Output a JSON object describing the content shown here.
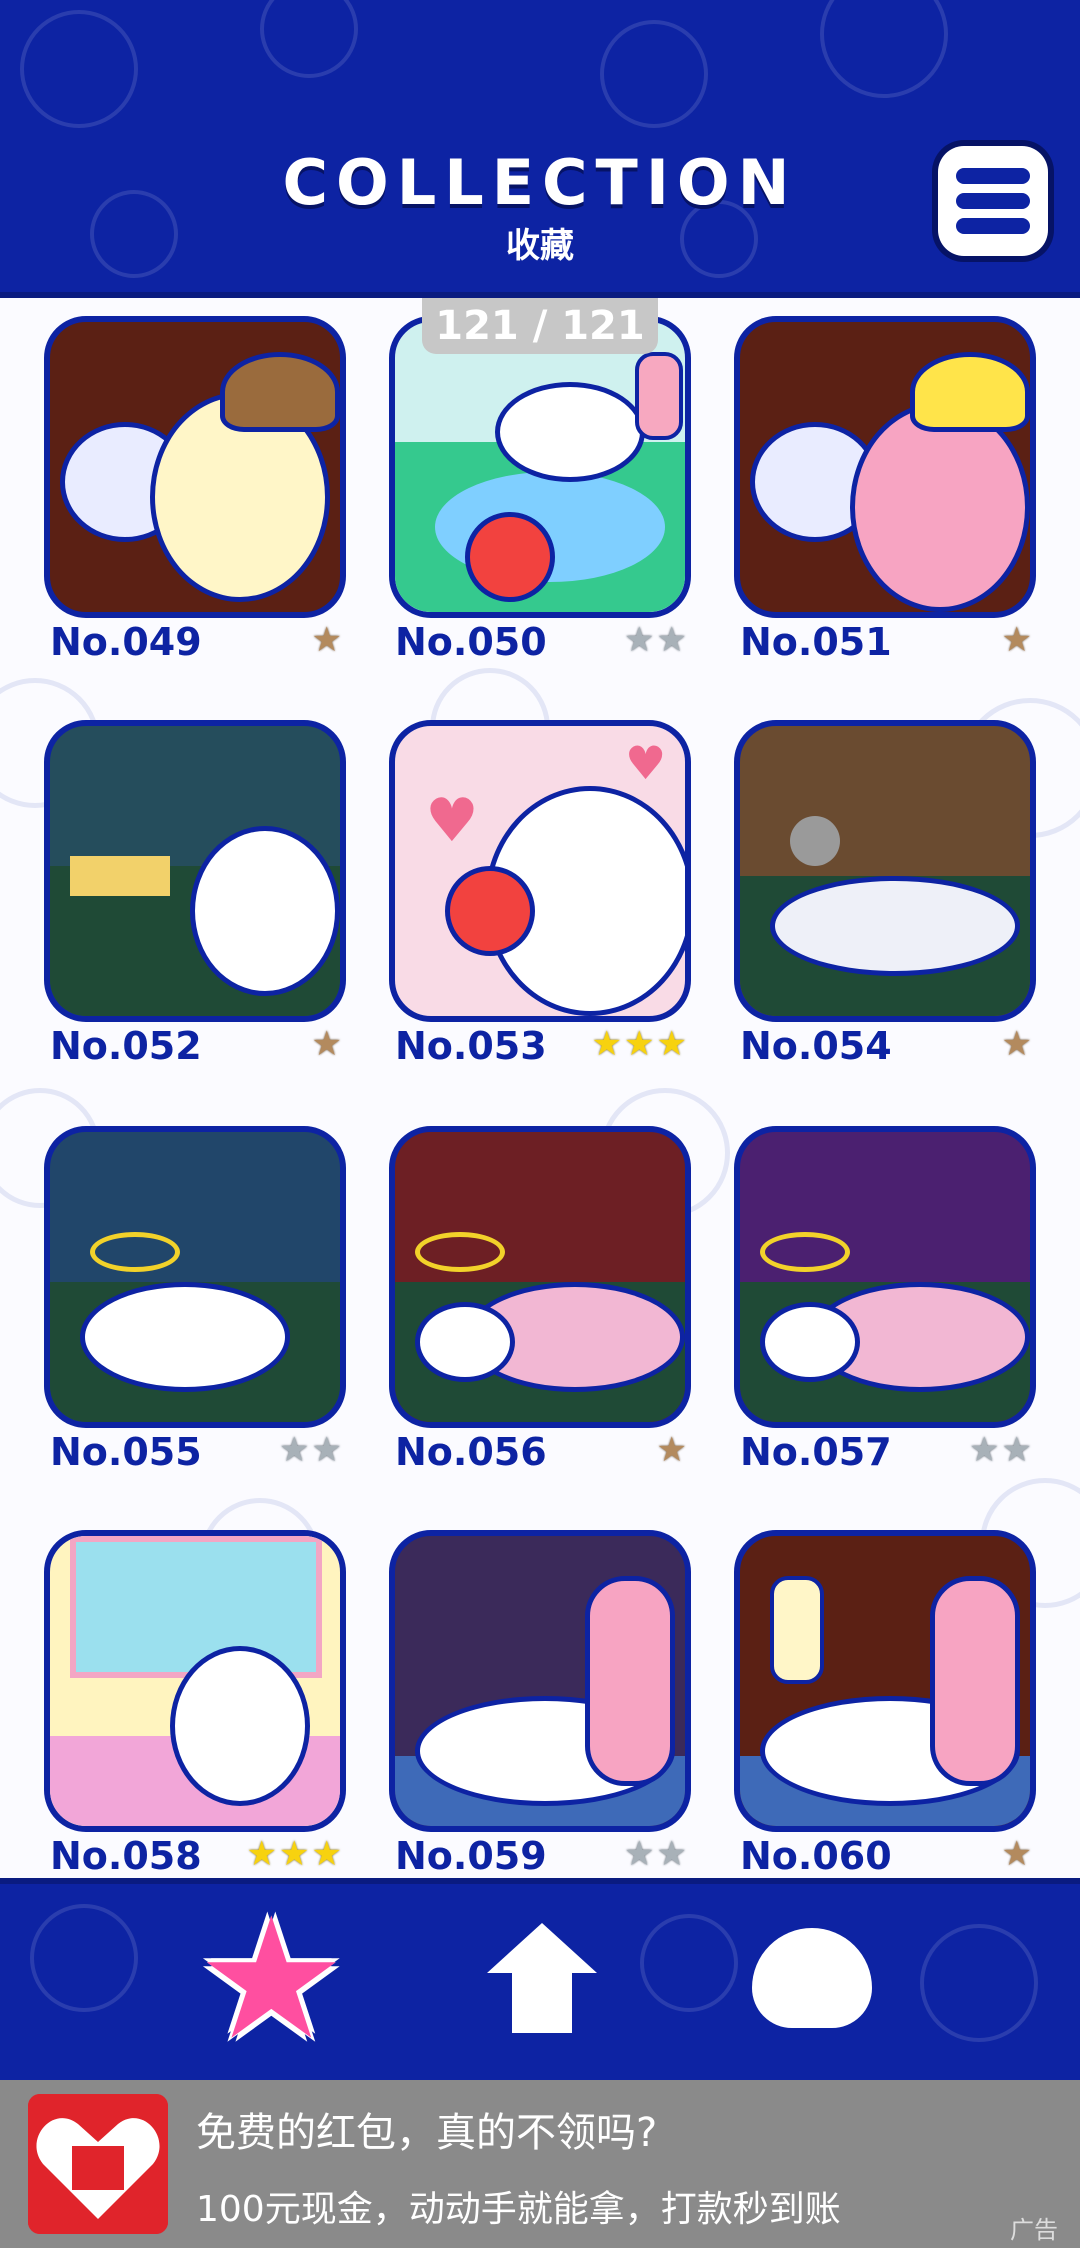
{
  "header": {
    "title": "COLLECTION",
    "subtitle": "收藏",
    "menu_icon": "menu-icon"
  },
  "counter": "121 / 121",
  "items": [
    {
      "number": "No.049",
      "stars": "★",
      "star_color": "brown",
      "scene": "hug"
    },
    {
      "number": "No.050",
      "stars": "★★",
      "star_color": "gray",
      "scene": "river-apple"
    },
    {
      "number": "No.051",
      "stars": "★",
      "star_color": "brown",
      "scene": "poodle-hug"
    },
    {
      "number": "No.052",
      "stars": "★",
      "star_color": "brown",
      "scene": "picnic"
    },
    {
      "number": "No.053",
      "stars": "★★★",
      "star_color": "gold",
      "scene": "apple-eat"
    },
    {
      "number": "No.054",
      "stars": "★",
      "star_color": "brown",
      "scene": "knocked-out"
    },
    {
      "number": "No.055",
      "stars": "★★",
      "star_color": "gray",
      "scene": "dizzy"
    },
    {
      "number": "No.056",
      "stars": "★",
      "star_color": "brown",
      "scene": "blanket"
    },
    {
      "number": "No.057",
      "stars": "★★",
      "star_color": "gray",
      "scene": "blanket-night"
    },
    {
      "number": "No.058",
      "stars": "★★★",
      "star_color": "gold",
      "scene": "wake-up"
    },
    {
      "number": "No.059",
      "stars": "★★",
      "star_color": "gray",
      "scene": "rain-sleep"
    },
    {
      "number": "No.060",
      "stars": "★",
      "star_color": "brown",
      "scene": "rain-sleep-friend"
    }
  ],
  "nav": {
    "star_icon": "star-icon",
    "home_icon": "home-icon",
    "bowl_icon": "bowl-icon"
  },
  "ad": {
    "title": "免费的红包，真的不领吗?",
    "description": "100元现金，动动手就能拿，打款秒到账",
    "tag": "广告"
  },
  "colors": {
    "primary": "#0d23a3",
    "star_brown": "#b38a5e",
    "star_gray": "#a8b1b8",
    "star_gold": "#f7d20f",
    "nav_star": "#ff4fa0"
  }
}
